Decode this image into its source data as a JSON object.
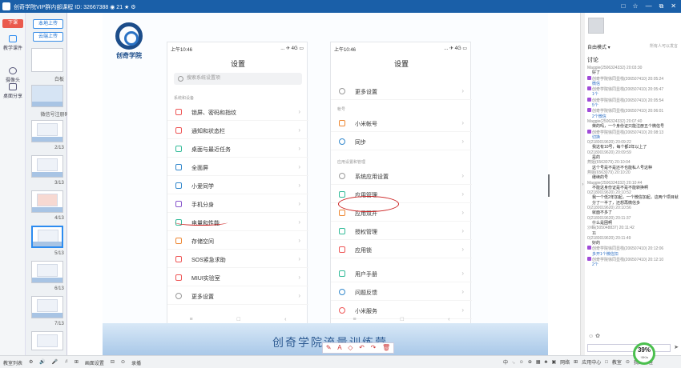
{
  "app": {
    "title": "创奇学院VIP群内部课程",
    "id_text": "ID: 32667388",
    "people_count": "21",
    "window_buttons": [
      "□",
      "☆",
      "—",
      "⧉",
      "✕"
    ]
  },
  "left_toolbar": {
    "download_btn": "下课",
    "items": [
      {
        "label": "教学课件",
        "icon": "slides-icon"
      },
      {
        "label": "摄像头",
        "icon": "camera-icon"
      },
      {
        "label": "桌面分享",
        "icon": "monitor-icon"
      }
    ]
  },
  "thumbnails": {
    "local_upload": "本地上传",
    "cloud_upload": "云端上传",
    "items": [
      {
        "label": "白板"
      },
      {
        "label": "微信号注册码的..."
      },
      {
        "label": "2/13"
      },
      {
        "label": "3/13"
      },
      {
        "label": "4/13"
      },
      {
        "label": "5/13"
      },
      {
        "label": "6/13"
      },
      {
        "label": "7/13"
      }
    ]
  },
  "slide": {
    "brand": "创奇学院",
    "footer": "创奇学院流量训练营",
    "left_phone": {
      "time": "上午10:46",
      "signal": "... ✈ 4G ▭",
      "title": "设置",
      "search_placeholder": "搜索系统设置项",
      "section": "系统和设备",
      "rows": [
        "锁屏、密码和指纹",
        "通知和状态栏",
        "桌面与最近任务",
        "全面屏",
        "小爱同学",
        "手机分身",
        "电量和性能",
        "存储空间",
        "SOS紧急求助",
        "MIUI实验室",
        "更多设置"
      ],
      "nav": [
        "≡",
        "□",
        "‹"
      ]
    },
    "right_phone": {
      "time": "上午10:46",
      "signal": "... ✈ 4G ▭",
      "title": "设置",
      "top_row": "更多设置",
      "section1": "帐号",
      "rows1": [
        "小米帐号",
        "同步"
      ],
      "section2": "应用设置和管理",
      "rows2": [
        "系统应用设置",
        "应用管理",
        "应用双开",
        "授权管理",
        "应用锁",
        "用户手册",
        "问题反馈",
        "小米服务"
      ],
      "nav": [
        "≡",
        "□",
        "‹"
      ]
    },
    "draw_tools": [
      "✎",
      "A",
      "◇",
      "↶",
      "↷",
      "🗑"
    ]
  },
  "chat": {
    "mode": "自由模式",
    "mode_hint": "所有人可以发言",
    "comment_label": "讨论",
    "messages": [
      {
        "who": "Maggie(2506324332) 20:03:30",
        "text": "好了"
      },
      {
        "who": "创奇学院徐同显栈(206507410) 20:05:24",
        "text": "微信",
        "gift": true
      },
      {
        "who": "创奇学院徐同显栈(206507410) 20:05:47",
        "text": "1个",
        "gift": true
      },
      {
        "who": "创奇学院徐同显栈(206507410) 20:05:54",
        "text": "5个",
        "gift": true
      },
      {
        "who": "创奇学院徐同显栈(206507410) 20:06:01",
        "text": "2个微信",
        "gift": true
      },
      {
        "who": "Maggie(2506324332) 20:07:40",
        "text": "荣的吗，一个身份证只能注册五个微信号"
      },
      {
        "who": "创奇学院徐同显栈(206507410) 20:08:13",
        "text": "切换",
        "gift": true
      },
      {
        "who": "0(2180019620) 20:09:22",
        "text": "我这有10号，每个都2年以上了"
      },
      {
        "who": "0(2180019620) 20:09:59",
        "text": "是的"
      },
      {
        "who": "燕姐(6563079) 20:10:04",
        "text": "这个号是不是还不也能私人号这种"
      },
      {
        "who": "燕姐(6563079) 20:10:20",
        "text": "继续的号"
      },
      {
        "who": "Maggie(2506324332) 20:10:44",
        "text": "不能这身份证是不是不能转换啊"
      },
      {
        "who": "0(2180019620) 20:10:52",
        "text": "我一个低2年加起，一个微信加起，这两个项目就分了一半了，还想再微信多"
      },
      {
        "who": "0(2180019620) 20:10:56",
        "text": "就面不多了"
      },
      {
        "who": "0(2180019620) 20:11:37",
        "text": "什么是困啊"
      },
      {
        "who": "沙蛛(505048837) 20:11:42",
        "text": "11"
      },
      {
        "who": "0(2180019620) 20:11:49",
        "text": "好的"
      },
      {
        "who": "创奇学院徐同显栈(206507410) 20:12:06",
        "text": "多开1个微信扣",
        "gift": true
      },
      {
        "who": "创奇学院徐同显栈(206507410) 20:12:10",
        "text": "2个",
        "gift": true
      }
    ],
    "emoji_row": "☺  ✿",
    "send": "➤"
  },
  "statusbar": {
    "left_items": [
      "教室列表",
      "⚙",
      "🔊",
      "🎤",
      "♫",
      "⊞",
      "画面设置",
      "⊟",
      "⊙",
      "录播"
    ],
    "right_items": [
      "中",
      "·,",
      "☺",
      "⊕",
      "▦",
      "♣",
      "▣",
      "网络",
      "⊞",
      "应用中心",
      "□",
      "教室",
      "⊙",
      "我的课程"
    ],
    "gauge_value": "39%",
    "gauge_sub": "↑0K/s"
  }
}
